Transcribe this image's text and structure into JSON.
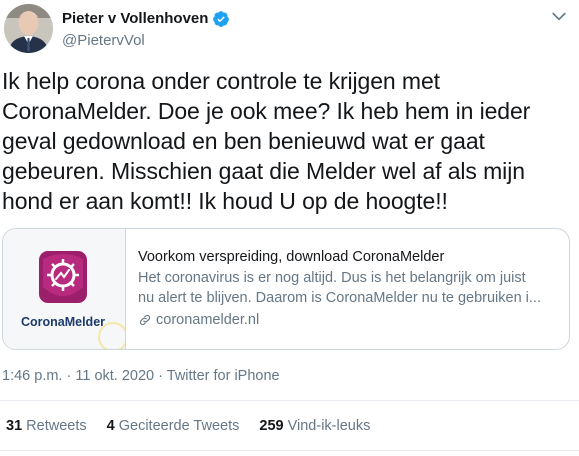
{
  "user": {
    "display_name": "Pieter v Vollenhoven",
    "handle": "@PietervVol",
    "verified": true
  },
  "tweet": {
    "text": "Ik help corona onder controle te krijgen met\nCoronaMelder. Doe je ook mee? Ik heb hem in ieder\ngeval gedownload en ben benieuwd wat er gaat\ngebeuren. Misschien gaat die Melder wel af als mijn\nhond er aan komt!! Ik houd U op de hoogte!!"
  },
  "card": {
    "logo_text": "CoronaMelder",
    "title": "Voorkom verspreiding, download CoronaMelder",
    "description_line1": "Het coronavirus is er nog altijd. Dus is het belangrijk om juist",
    "description_line2": "nu alert te blijven. Daarom is CoronaMelder nu te gebruiken i...",
    "url": "coronamelder.nl"
  },
  "meta": {
    "time": "1:46 p.m.",
    "date": "11 okt. 2020",
    "separator": "·",
    "source": "Twitter for iPhone"
  },
  "stats": {
    "retweets_count": "31",
    "retweets_label": "Retweets",
    "quotes_count": "4",
    "quotes_label": "Geciteerde Tweets",
    "likes_count": "259",
    "likes_label": "Vind-ik-leuks"
  },
  "icons": {
    "verified": "verified-badge-icon",
    "caret": "chevron-down-icon",
    "link": "link-icon"
  },
  "colors": {
    "verified": "#1da1f2",
    "logo_primary": "#9c1f6b",
    "logo_text": "#1b3a6b",
    "muted_text": "#657786"
  }
}
